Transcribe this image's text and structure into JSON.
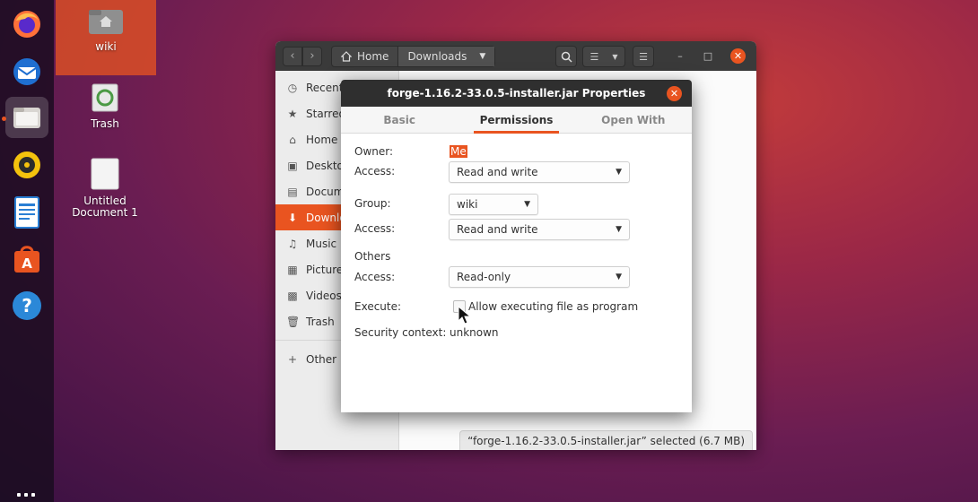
{
  "desktop": {
    "icons": [
      {
        "label": "wiki"
      },
      {
        "label": "Trash"
      },
      {
        "label": "Untitled Document 1"
      }
    ]
  },
  "dock": {
    "items": [
      "Firefox",
      "Thunderbird",
      "Files",
      "Rhythmbox",
      "LibreOffice Writer",
      "Ubuntu Software",
      "Help"
    ],
    "active": "Files"
  },
  "file_manager": {
    "path": [
      "Home",
      "Downloads"
    ],
    "sidebar": [
      {
        "label": "Recent",
        "icon": "clock-icon"
      },
      {
        "label": "Starred",
        "icon": "star-icon"
      },
      {
        "label": "Home",
        "icon": "home-icon"
      },
      {
        "label": "Desktop",
        "icon": "desktop-icon"
      },
      {
        "label": "Documents",
        "icon": "document-icon"
      },
      {
        "label": "Downloads",
        "icon": "download-icon"
      },
      {
        "label": "Music",
        "icon": "music-icon"
      },
      {
        "label": "Pictures",
        "icon": "picture-icon"
      },
      {
        "label": "Videos",
        "icon": "video-icon"
      },
      {
        "label": "Trash",
        "icon": "trash-icon"
      },
      {
        "label": "Other Locations",
        "icon": "plus-icon"
      }
    ],
    "status": "“forge-1.16.2-33.0.5-installer.jar” selected  (6.7 MB)"
  },
  "dialog": {
    "title": "forge-1.16.2-33.0.5-installer.jar Properties",
    "tabs": [
      "Basic",
      "Permissions",
      "Open With"
    ],
    "active_tab": "Permissions",
    "owner_label": "Owner:",
    "owner_value": "Me",
    "owner_access_label": "Access:",
    "owner_access": "Read and write",
    "group_label": "Group:",
    "group_value": "wiki",
    "group_access_label": "Access:",
    "group_access": "Read and write",
    "others_label": "Others",
    "others_access_label": "Access:",
    "others_access": "Read-only",
    "execute_label": "Execute:",
    "execute_checkbox_label": "Allow executing file as program",
    "execute_checked": false,
    "security_label": "Security context:",
    "security_value": "unknown"
  },
  "colors": {
    "accent": "#e95420",
    "titlebar": "#2f2f2f"
  }
}
